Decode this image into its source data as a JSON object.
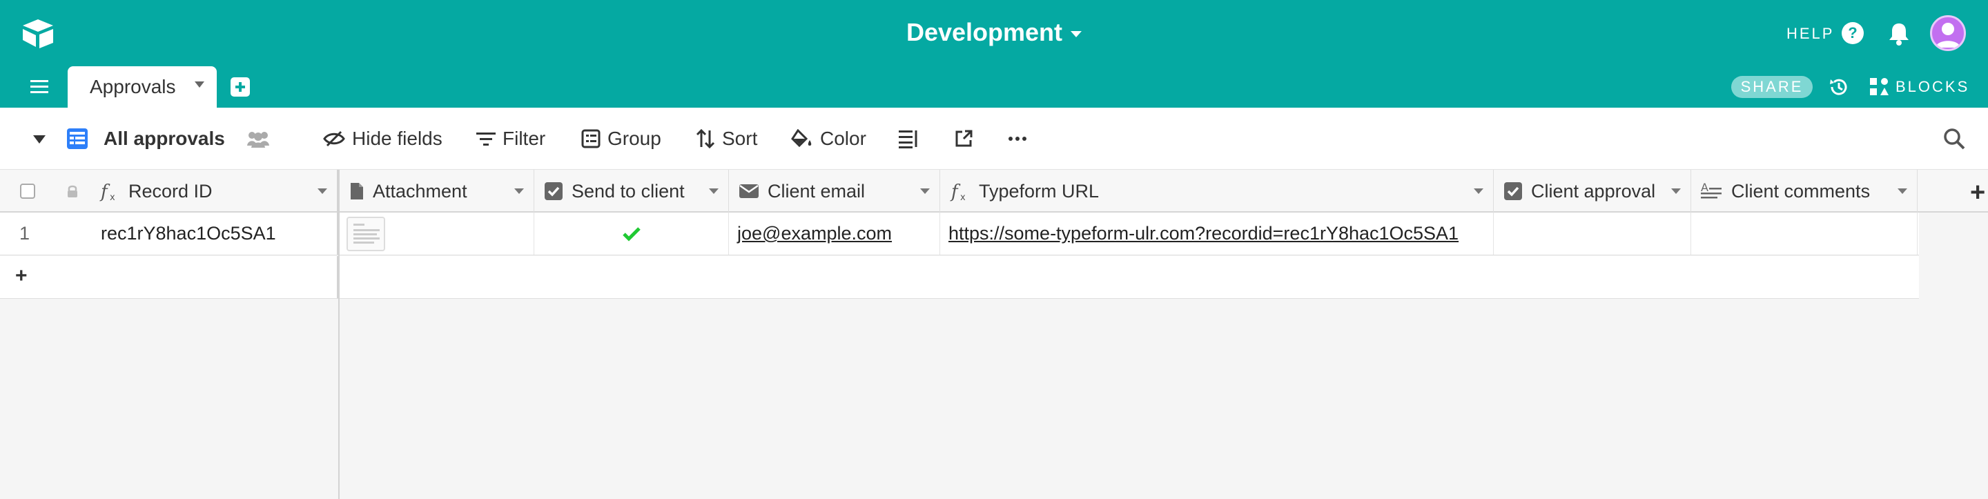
{
  "app": {
    "base_name": "Development",
    "help_label": "HELP",
    "share_label": "SHARE",
    "blocks_label": "BLOCKS"
  },
  "tabs": [
    {
      "label": "Approvals",
      "active": true
    }
  ],
  "toolbar": {
    "view_name": "All approvals",
    "hide_fields": "Hide fields",
    "filter": "Filter",
    "group": "Group",
    "sort": "Sort",
    "color": "Color"
  },
  "columns": [
    {
      "label": "Record ID",
      "icon": "formula-icon"
    },
    {
      "label": "Attachment",
      "icon": "attachment-icon"
    },
    {
      "label": "Send to client",
      "icon": "checkbox-icon"
    },
    {
      "label": "Client email",
      "icon": "email-icon"
    },
    {
      "label": "Typeform URL",
      "icon": "formula-icon"
    },
    {
      "label": "Client approval",
      "icon": "checkbox-icon"
    },
    {
      "label": "Client comments",
      "icon": "long-text-icon"
    }
  ],
  "rows": [
    {
      "number": "1",
      "record_id": "rec1rY8hac1Oc5SA1",
      "attachment": "file-thumbnail",
      "send_to_client": true,
      "client_email": "joe@example.com",
      "typeform_url": "https://some-typeform-ulr.com?recordid=rec1rY8hac1Oc5SA1",
      "client_approval": false,
      "client_comments": ""
    }
  ],
  "add_row_symbol": "+",
  "add_field_symbol": "+",
  "colors": {
    "header_bg": "#05a9a2",
    "check_green": "#20c933",
    "avatar": "#c26ff0",
    "view_icon": "#2d7ff9"
  }
}
